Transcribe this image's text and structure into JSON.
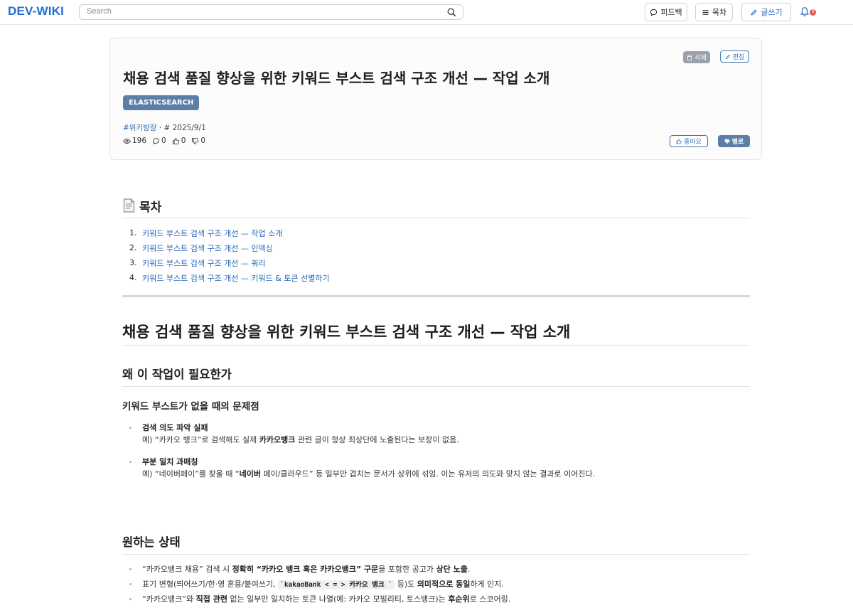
{
  "header": {
    "logo": "DEV-WIKI",
    "search_placeholder": "Search",
    "feedback_label": "피드백",
    "toc_label": "목차",
    "write_label": "글쓰기",
    "notification_badge": "0"
  },
  "post": {
    "title": "채용 검색 품질 향상을 위한 키워드 부스트 검색 구조 개선 — 작업 소개",
    "category_badge": "ELASTICSEARCH",
    "tag": "#위키방장",
    "date": "· # 2025/9/1",
    "views": "196",
    "comments": "0",
    "likes": "0",
    "dislikes": "0",
    "delete_label": "삭제",
    "edit_label": "편집",
    "like_label": "좋아요",
    "dislike_label": "별로"
  },
  "toc": {
    "title": "목차",
    "items": [
      {
        "num": "1.",
        "label": "키워드 부스트 검색 구조 개선 — 작업 소개"
      },
      {
        "num": "2.",
        "label": "키워드 부스트 검색 구조 개선 — 인덱싱"
      },
      {
        "num": "3.",
        "label": "키워드 부스트 검색 구조 개선 — 쿼리"
      },
      {
        "num": "4.",
        "label": "키워드 부스트 검색 구조 개선 — 키워드 & 토큰 선별하기"
      }
    ]
  },
  "article": {
    "h1": "채용 검색 품질 향상을 위한 키워드 부스트 검색 구조 개선 — 작업 소개",
    "why_heading": "왜 이 작업이 필요한가",
    "problem_heading": "키워드 부스트가 없을 때의 문제점",
    "problems": [
      {
        "title": "검색 의도 파악 실패",
        "pre": "예) “카카오 뱅크”로 검색해도 실제 ",
        "strong": "카카오뱅크",
        "post": " 관련 글이 항상 최상단에 노출된다는 보장이 없음."
      },
      {
        "title": "부분 일치 과매칭",
        "pre": "예) “네이버페이”를 찾을 때 “",
        "strong": "네이버",
        "post": " 페이/클라우드” 등 일부만 겹치는 문서가 상위에 섞임. 이는 유저의 의도와 맞지 않는 결과로 이어진다."
      }
    ],
    "desired_heading": "원하는 상태",
    "desired": {
      "item1": {
        "a": "“카카오뱅크 채용” 검색 시 ",
        "b": "정확히 “카카오 뱅크 혹은 카카오뱅크” 구문",
        "c": "을 포함한 공고가 ",
        "d": "상단 노출",
        "e": "."
      },
      "item2": {
        "a": "표기 변형(띄어쓰기/한·영 혼용/붙여쓰기, ",
        "code": "`kakaoBank < = > 카카오 뱅크 `",
        "b": " 등)도 ",
        "c": "의미적으로 동일",
        "d": "하게 인지."
      },
      "item3": {
        "a": "“카카오뱅크”와 ",
        "b": "직접 관련",
        "c": " 없는 일부만 일치하는 토큰 나열(예: 카카오 모빌리티, 토스뱅크)는 ",
        "d": "후순위",
        "e": "로 스코어링."
      }
    }
  },
  "colors": {
    "brand": "#1f6fd1",
    "link": "#2466b8",
    "badge": "#5b7fa6"
  }
}
